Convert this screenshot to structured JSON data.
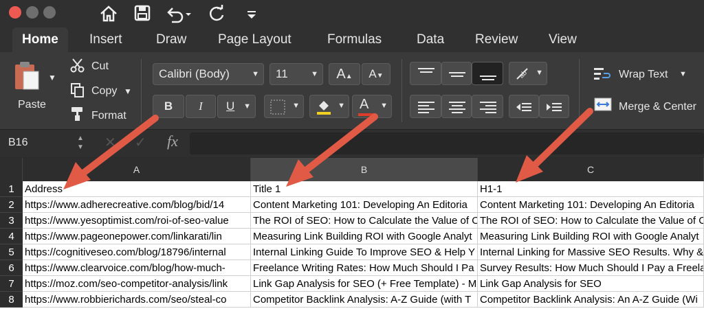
{
  "toolbar": {
    "home_icon": "home-icon",
    "save_icon": "save-icon",
    "undo_icon": "undo-icon",
    "redo_icon": "redo-icon",
    "customize_icon": "customize-icon"
  },
  "tabs": [
    {
      "label": "Home",
      "active": true
    },
    {
      "label": "Insert"
    },
    {
      "label": "Draw"
    },
    {
      "label": "Page Layout"
    },
    {
      "label": "Formulas"
    },
    {
      "label": "Data"
    },
    {
      "label": "Review"
    },
    {
      "label": "View"
    }
  ],
  "ribbon": {
    "paste_label": "Paste",
    "cut_label": "Cut",
    "copy_label": "Copy",
    "format_label": "Format",
    "font_name": "Calibri (Body)",
    "font_size": "11",
    "bold": "B",
    "italic": "I",
    "underline": "U",
    "font_color_glyph": "A",
    "wrap_text": "Wrap Text",
    "merge_center": "Merge & Center"
  },
  "formula_bar": {
    "name_box": "B16",
    "fx": "fx"
  },
  "columns": [
    "A",
    "B",
    "C"
  ],
  "rows": [
    {
      "num": "1",
      "a": "Address",
      "b": "Title 1",
      "c": "H1-1"
    },
    {
      "num": "2",
      "a": "https://www.adherecreative.com/blog/bid/14",
      "b": "Content Marketing 101: Developing An Editoria",
      "c": "Content Marketing 101: Developing An Editoria"
    },
    {
      "num": "3",
      "a": "https://www.yesoptimist.com/roi-of-seo-value",
      "b": "The ROI of SEO: How to Calculate the Value of O",
      "c": "The ROI of SEO: How to Calculate the Value of O"
    },
    {
      "num": "4",
      "a": "https://www.pageonepower.com/linkarati/lin",
      "b": "Measuring Link Building ROI with Google Analyt",
      "c": "Measuring Link Building ROI with Google Analyt"
    },
    {
      "num": "5",
      "a": "https://cognitiveseo.com/blog/18796/internal",
      "b": "Internal Linking Guide To Improve SEO & Help Y",
      "c": "Internal Linking for Massive SEO Results. Why &"
    },
    {
      "num": "6",
      "a": "https://www.clearvoice.com/blog/how-much-",
      "b": "Freelance Writing Rates: How Much Should I Pa",
      "c": "Survey Results: How Much Should I Pay a Freela"
    },
    {
      "num": "7",
      "a": "https://moz.com/seo-competitor-analysis/link",
      "b": "Link Gap Analysis for SEO (+ Free Template) - Mo",
      "c": "Link Gap Analysis for SEO"
    },
    {
      "num": "8",
      "a": "https://www.robbierichards.com/seo/steal-co",
      "b": "Competitor Backlink Analysis: A-Z Guide (with T",
      "c": "Competitor Backlink Analysis: An A-Z Guide (Wi"
    }
  ],
  "colors": {
    "annotation_arrow": "#e05a46",
    "traffic_close": "#ee5a52",
    "traffic_other": "#6e6e6e"
  }
}
